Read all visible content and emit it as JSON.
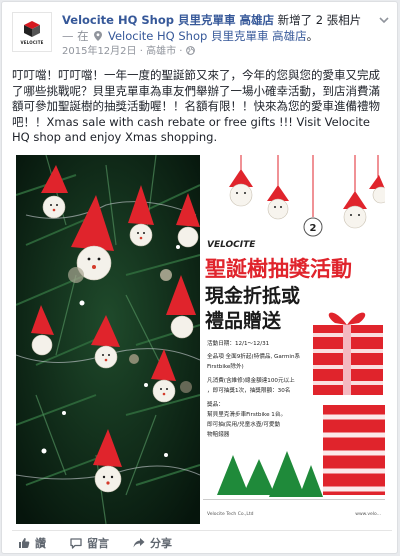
{
  "header": {
    "page_name": "Velocite HQ Shop 貝里克單車 高雄店",
    "activity": "新增了 2 張相片",
    "with_prefix": "— 在",
    "location": "Velocite HQ Shop 貝里克單車 高雄店",
    "location_suffix": "。",
    "timestamp": "2015年12月2日",
    "place": "高雄市",
    "avatar_text": "VELOCITE"
  },
  "post": {
    "text": "叮叮噹！叮叮噹！一年一度的聖誕節又來了，今年的您與您的愛車又完成了哪些挑戰呢？貝里克單車為車友們舉辦了一場小確幸活動，到店消費滿額可參加聖誕樹的抽獎活動喔！！名額有限！！快來為您的愛車進備禮物吧！！Xmas sale with cash rebate or free gifts !!! Visit Velocite HQ shop and enjoy Xmas shopping."
  },
  "poster": {
    "brand": "VELOCITE",
    "title": "聖誕樹抽獎活動",
    "subtitle_1": "現金折抵或",
    "subtitle_2": "禮品贈送",
    "number": "2",
    "line_1": "活動日期：12/1～12/31",
    "line_2": "全品項 全面9折起(特價品, Garmin系",
    "line_3": "Firstbike除外)",
    "line_4": "凡消費(含維修)總金額達100元以上",
    "line_5": "，即可抽獎1次，抽獎限額：30名",
    "line_6": "獎品：",
    "line_7": "幫貝里克滑步車Firstbike 1台。",
    "line_8": "即可抽(民用/兒童水壺/可愛動",
    "line_9": "物賠錢器",
    "footer_left": "Velocite Tech Co.,Ltd",
    "footer_right": "www.velo..."
  },
  "actions": {
    "like": "讚",
    "comment": "留言",
    "share": "分享"
  },
  "colors": {
    "link": "#365899",
    "muted": "#90949c",
    "poster_red": "#e0242c",
    "poster_green": "#1f8a3a"
  }
}
